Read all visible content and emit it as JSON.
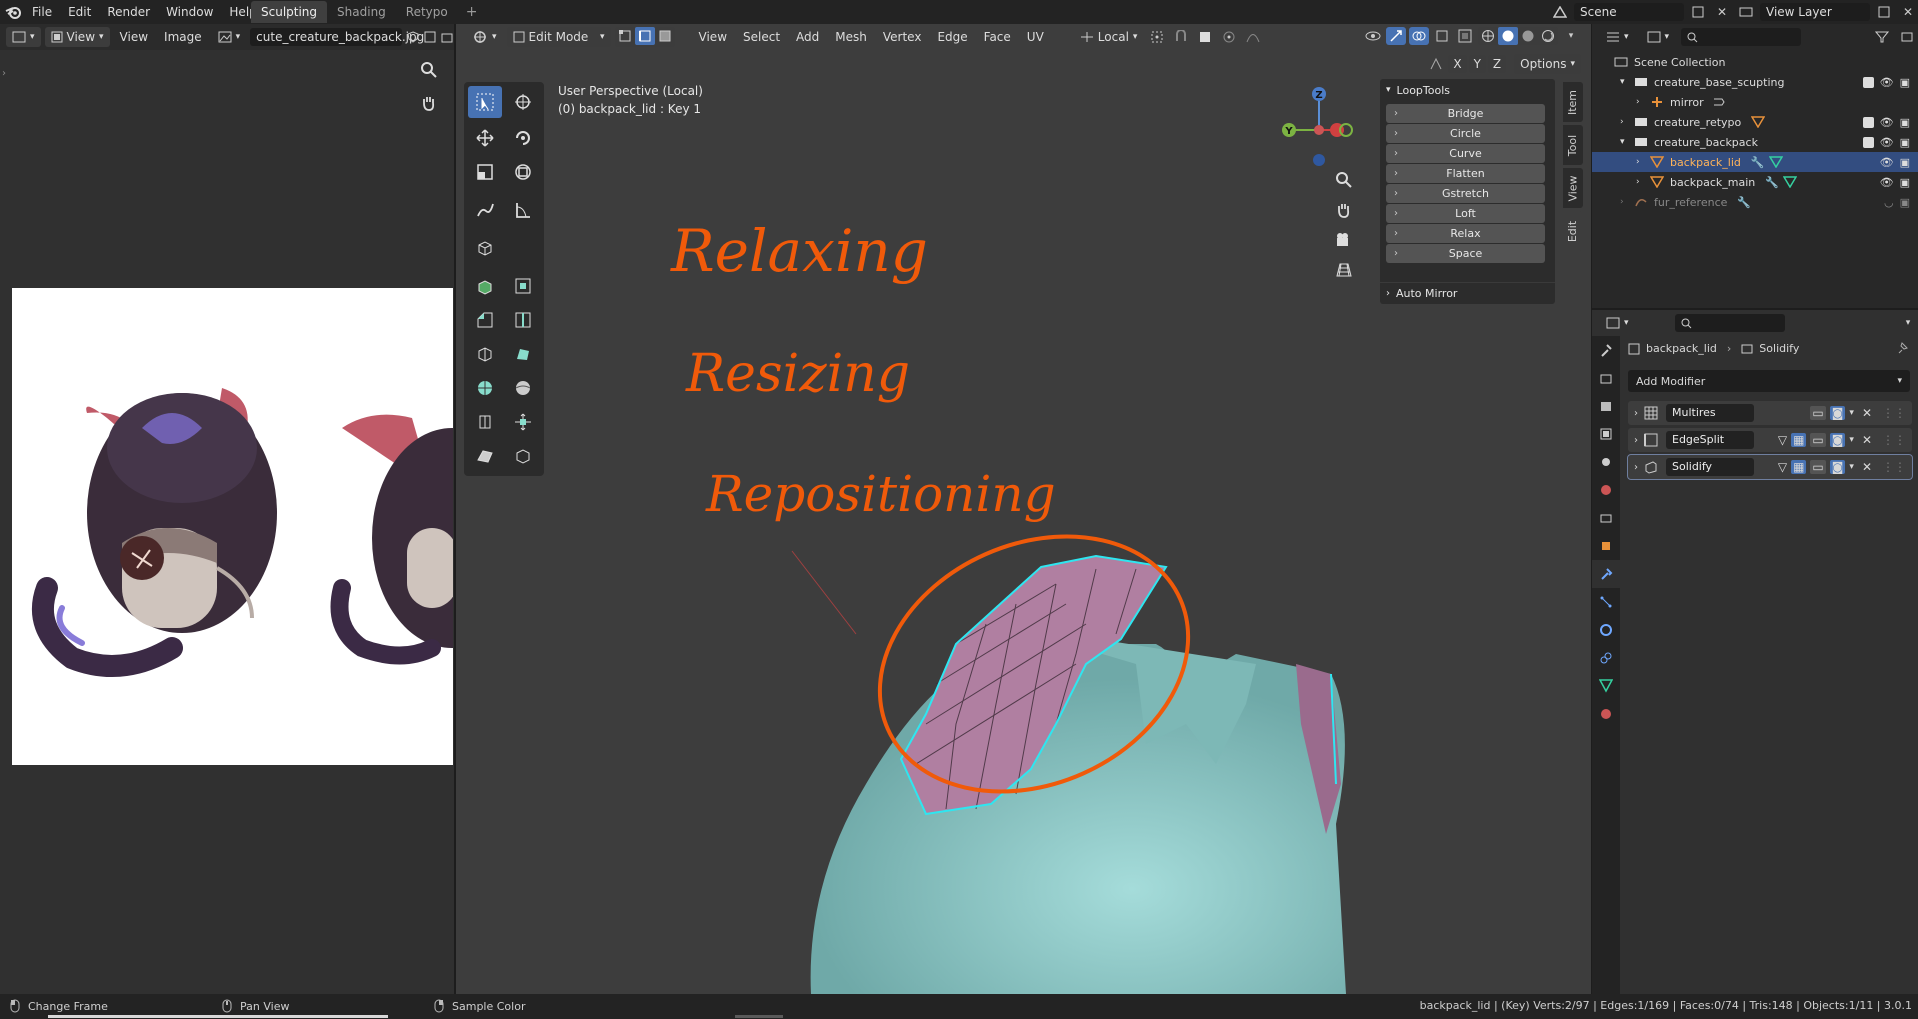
{
  "topbar": {
    "menus": [
      "File",
      "Edit",
      "Render",
      "Window",
      "Help"
    ],
    "workspaces": [
      "Sculpting",
      "Shading",
      "Retypo"
    ],
    "active_workspace": "Sculpting",
    "scene": "Scene",
    "view_layer": "View Layer"
  },
  "image_editor": {
    "view_label": "View",
    "menus": [
      "View",
      "Image"
    ],
    "image_name": "cute_creature_backpack.jpg"
  },
  "viewport": {
    "mode": "Edit Mode",
    "menus": [
      "View",
      "Select",
      "Add",
      "Mesh",
      "Vertex",
      "Edge",
      "Face",
      "UV"
    ],
    "orientation": "Local",
    "options_label": "Options",
    "axes": [
      "X",
      "Y",
      "Z"
    ],
    "overlay_line1": "User Perspective (Local)",
    "overlay_line2": "(0) backpack_lid : Key 1",
    "annotation_lines": [
      "Relaxing",
      "Resizing",
      "Repositioning"
    ],
    "annotation_color": "#f05a0a",
    "gizmo_labels": {
      "x": "X",
      "y": "Y",
      "z": "Z"
    }
  },
  "looptools": {
    "title": "LoopTools",
    "buttons": [
      "Bridge",
      "Circle",
      "Curve",
      "Flatten",
      "Gstretch",
      "Loft",
      "Relax",
      "Space"
    ],
    "auto_mirror": "Auto Mirror"
  },
  "side_tabs": [
    "Item",
    "Tool",
    "View",
    "Edit"
  ],
  "outliner": {
    "search_placeholder": "",
    "root": "Scene Collection",
    "items": [
      {
        "label": "creature_base_scupting",
        "type": "collection"
      },
      {
        "label": "mirror",
        "type": "object"
      },
      {
        "label": "creature_retypo",
        "type": "collection"
      },
      {
        "label": "creature_backpack",
        "type": "collection"
      },
      {
        "label": "backpack_lid",
        "type": "mesh",
        "selected": true
      },
      {
        "label": "backpack_main",
        "type": "mesh"
      },
      {
        "label": "fur_reference",
        "type": "object"
      }
    ]
  },
  "properties": {
    "object": "backpack_lid",
    "modifier_context": "Solidify",
    "add_modifier": "Add Modifier",
    "modifiers": [
      "Multires",
      "EdgeSplit",
      "Solidify"
    ]
  },
  "status": {
    "items": [
      "Change Frame",
      "Pan View",
      "Sample Color"
    ],
    "stats": "backpack_lid | (Key) Verts:2/97 | Edges:1/169 | Faces:0/74 | Tris:148 | Objects:1/11 | 3.0.1"
  },
  "colors": {
    "accent": "#4772b3",
    "annotation": "#f05a0a",
    "mesh_teal": "#8ec9c7",
    "mesh_lid": "#b07fa1",
    "edge_highlight": "#2ee6f0"
  }
}
